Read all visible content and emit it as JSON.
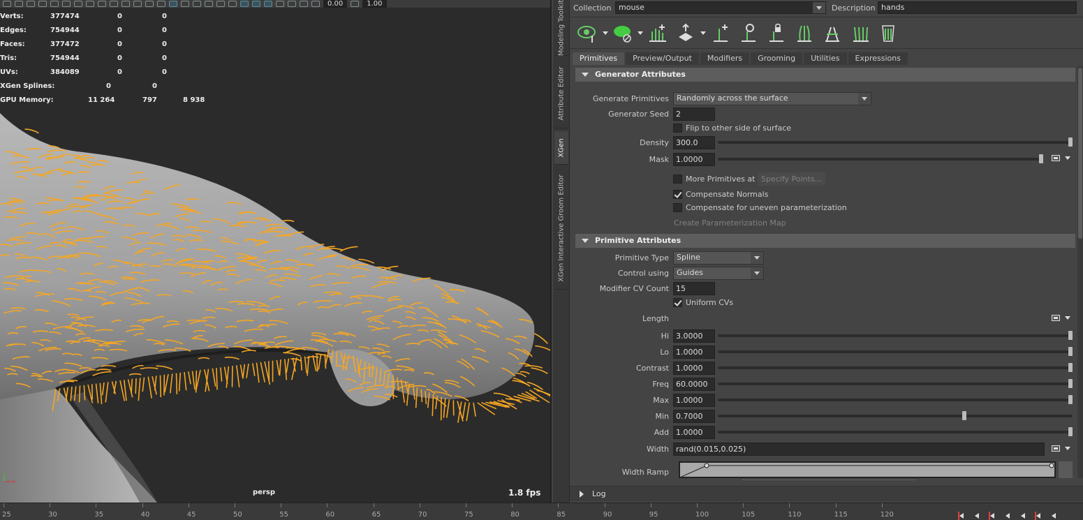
{
  "viewport": {
    "toolbar": {
      "value_a": "0.00",
      "value_b": "1.00"
    },
    "hud": [
      {
        "label": "Verts:",
        "v1": "377474",
        "v2": "0",
        "v3": "0"
      },
      {
        "label": "Edges:",
        "v1": "754944",
        "v2": "0",
        "v3": "0"
      },
      {
        "label": "Faces:",
        "v1": "377472",
        "v2": "0",
        "v3": "0"
      },
      {
        "label": "Tris:",
        "v1": "754944",
        "v2": "0",
        "v3": "0"
      },
      {
        "label": "UVs:",
        "v1": "384089",
        "v2": "0",
        "v3": "0"
      },
      {
        "label": "XGen Splines:",
        "v1": "0",
        "v2": "0",
        "v3": ""
      },
      {
        "label": "GPU Memory:",
        "v1": "11 264",
        "v2": "797",
        "v3": "8 938"
      }
    ],
    "camera": "persp",
    "fps": "1.8 fps",
    "hair_color": "#f5a623"
  },
  "vertical_tabs": [
    "Modeling Toolkit",
    "Attribute Editor",
    "XGen",
    "XGen Interactive Groom Editor"
  ],
  "panel": {
    "collection_label": "Collection",
    "collection_value": "mouse",
    "description_label": "Description",
    "description_value": "hands",
    "icons": [
      "visibility-eye-icon",
      "preview-primitives-icon",
      "add-guides-icon",
      "guide-move-icon",
      "add-guide-icon",
      "select-guide-icon",
      "lock-guide-icon",
      "rebuild-guides-icon",
      "flip-guides-icon",
      "normalize-guides-icon",
      "bake-guides-icon"
    ],
    "tabs": [
      "Primitives",
      "Preview/Output",
      "Modifiers",
      "Grooming",
      "Utilities",
      "Expressions"
    ],
    "active_tab": "Primitives",
    "generator": {
      "title": "Generator Attributes",
      "generate_primitives_label": "Generate Primitives",
      "generate_primitives_value": "Randomly across the surface",
      "seed_label": "Generator Seed",
      "seed_value": "2",
      "flip_label": "Flip to other side of surface",
      "density_label": "Density",
      "density_value": "300.0",
      "density_level": 1.0,
      "mask_label": "Mask",
      "mask_value": "1.0000",
      "mask_level": 1.0,
      "more_primitives_label": "More Primitives at",
      "specify_points_label": "Specify Points...",
      "compensate_normals_label": "Compensate Normals",
      "compensate_uneven_label": "Compensate for uneven parameterization",
      "create_param_map_label": "Create Parameterization Map"
    },
    "primitive": {
      "title": "Primitive Attributes",
      "type_label": "Primitive Type",
      "type_value": "Spline",
      "control_label": "Control using",
      "control_value": "Guides",
      "cv_count_label": "Modifier CV Count",
      "cv_count_value": "15",
      "uniform_cvs_label": "Uniform CVs",
      "length_label": "Length",
      "sliders": [
        {
          "label": "Hi",
          "value": "3.0000",
          "level": 1.0
        },
        {
          "label": "Lo",
          "value": "1.0000",
          "level": 1.0
        },
        {
          "label": "Contrast",
          "value": "1.0000",
          "level": 1.0
        },
        {
          "label": "Freq",
          "value": "60.0000",
          "level": 1.0
        },
        {
          "label": "Max",
          "value": "1.0000",
          "level": 1.0
        },
        {
          "label": "Min",
          "value": "0.7000",
          "level": 0.7
        },
        {
          "label": "Add",
          "value": "1.0000",
          "level": 1.0
        }
      ],
      "width_label": "Width",
      "width_value": "rand(0.015,0.025)",
      "width_ramp_label": "Width Ramp"
    },
    "log_label": "Log"
  },
  "timeline": {
    "ticks": [
      "25",
      "30",
      "35",
      "40",
      "45",
      "50",
      "55",
      "60",
      "65",
      "70",
      "75",
      "80",
      "85",
      "90",
      "95",
      "100",
      "105",
      "110",
      "115",
      "120"
    ]
  }
}
